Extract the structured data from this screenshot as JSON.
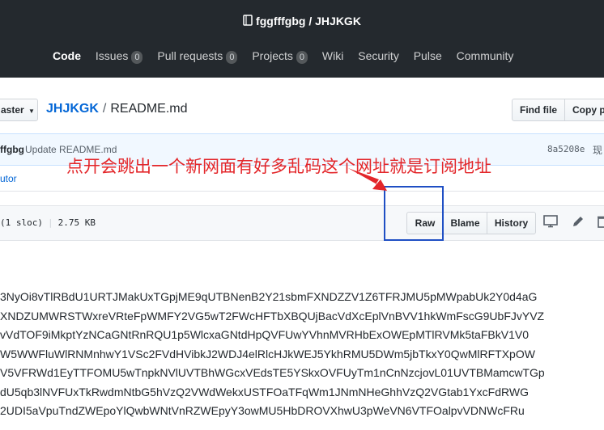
{
  "repo": {
    "owner": "fggfffgbg",
    "name": "JHJKGK",
    "separator": "/"
  },
  "nav": [
    {
      "label": "Code",
      "active": true
    },
    {
      "label": "Issues",
      "count": "0"
    },
    {
      "label": "Pull requests",
      "count": "0"
    },
    {
      "label": "Projects",
      "count": "0"
    },
    {
      "label": "Wiki"
    },
    {
      "label": "Security"
    },
    {
      "label": "Pulse"
    },
    {
      "label": "Community"
    }
  ],
  "branch": {
    "label": "aster"
  },
  "breadcrumb": {
    "repo": "JHJKGK",
    "file": "README.md",
    "sep": "/"
  },
  "buttons": {
    "find_file": "Find file",
    "copy_path": "Copy p"
  },
  "commit": {
    "author": "ffgbg",
    "message": "Update README.md",
    "sha": "8a5208e",
    "time": "现"
  },
  "contributors": {
    "label": "utor"
  },
  "file": {
    "lines": "(1 sloc)",
    "size": "2.75 KB",
    "raw": "Raw",
    "blame": "Blame",
    "history": "History"
  },
  "annotation": {
    "text": "点开会跳出一个新网面有好多乱码这个网址就是订阅地址",
    "color": "#e3262a"
  },
  "content_lines": [
    "3NyOi8vTlRBdU1URTJMakUxTGpjME9qUTBNenB2Y21sbmFXNDZZV1Z6TFRJMU5pMWpabUk2Y0d4aG",
    "XNDZUMWRSTWxreVRteFpWMFY2VG5wT2FWcHFTbXBQUjBacVdXcEplVnBVV1hkWmFscG9UbFJvYVZ",
    "vVdTOF9iMkptYzNCaGNtRnRQU1p5WlcxaGNtdHpQVFUwYVhnMVRHbExOWEpMTlRVMk5taFBkV1V0",
    "W5WWFluWlRNMnhwY1VSc2FVdHVibkJ2WDJ4elRlcHJkWEJ5YkhRMU5DWm5jbTkxY0QwMlRFTXpOW",
    "V5VFRWd1EyTTFOMU5wTnpkNVlUVTBhWGcxVEdsTE5YSkxOVFUyTm1nCnNzcjovL01UVTBMamcwTGp",
    "dU5qb3lNVFUxTkRwdmNtbG5hVzQ2VWdWekxUSTFOaTFqWm1JNmNHeGhhVzQ2VGtab1YxcFdRWG",
    "2UDI5aVpuTndZWEpoYlQwbWNtVnRZWEpyY3owMU5HbDROVXhwU3pWeVN6VTFOalpvVDNWcFRu"
  ]
}
